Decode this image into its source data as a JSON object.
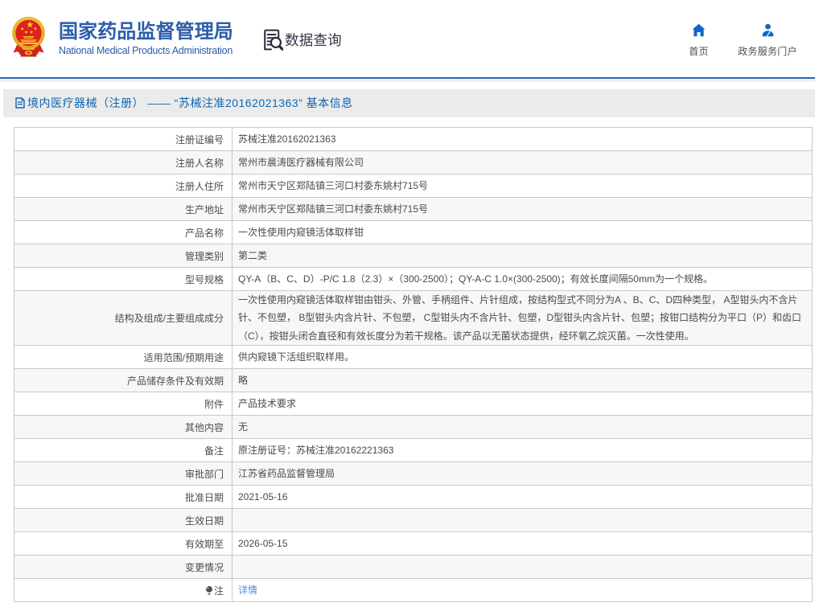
{
  "header": {
    "brand_title": "国家药品监督管理局",
    "brand_subtitle": "National Medical Products Administration",
    "data_search_label": "数据查询",
    "nav_home_label": "首页",
    "nav_portal_label": "政务服务门户"
  },
  "breadcrumb": {
    "text": "境内医疗器械（注册） —— “苏械注准20162021363” 基本信息"
  },
  "colors": {
    "brand_blue": "#2a5da9",
    "header_border_blue": "#2a65b5",
    "crumb_bar_bg": "#ebebeb",
    "crumb_text_blue": "#0d65b5",
    "table_border": "#c9c9c9",
    "row_alt_bg": "#f7f7f7",
    "link_blue": "#4192e0",
    "text_gray": "#4a4a4a"
  },
  "table": {
    "rows": [
      {
        "label": "注册证编号",
        "value": "苏械注准20162021363"
      },
      {
        "label": "注册人名称",
        "value": "常州市晨涛医疗器械有限公司"
      },
      {
        "label": "注册人住所",
        "value": "常州市天宁区郑陆镇三河口村委东姚村715号"
      },
      {
        "label": "生产地址",
        "value": "常州市天宁区郑陆镇三河口村委东姚村715号"
      },
      {
        "label": "产品名称",
        "value": "一次性使用内窥镜活体取样钳"
      },
      {
        "label": "管理类别",
        "value": "第二类"
      },
      {
        "label": "型号规格",
        "value": "QY-A（B、C、D）-P/C 1.8（2.3）×（300-2500）；QY-A-C 1.0×(300-2500)；有效长度间隔50mm为一个规格。"
      },
      {
        "label": "结构及组成/主要组成成分",
        "value": "一次性使用内窥镜活体取样钳由钳头、外管、手柄组件、片针组成，按结构型式不同分为A 、B、C、D四种类型， A型钳头内不含片针、不包塑， B型钳头内含片针、不包塑， C型钳头内不含片针、包塑，D型钳头内含片针、包塑；按钳口结构分为平口（P）和齿口（C），按钳头闭合直径和有效长度分为若干规格。该产品以无菌状态提供，经环氧乙烷灭菌。一次性使用。",
        "tall": true
      },
      {
        "label": "适用范围/预期用途",
        "value": "供内窥镜下活组织取样用。"
      },
      {
        "label": "产品储存条件及有效期",
        "value": "略"
      },
      {
        "label": "附件",
        "value": "产品技术要求"
      },
      {
        "label": "其他内容",
        "value": "无"
      },
      {
        "label": "备注",
        "value": "原注册证号：苏械注准20162221363"
      },
      {
        "label": "审批部门",
        "value": "江苏省药品监督管理局"
      },
      {
        "label": "批准日期",
        "value": "2021-05-16"
      },
      {
        "label": "生效日期",
        "value": ""
      },
      {
        "label": "有效期至",
        "value": "2026-05-15"
      },
      {
        "label": "变更情况",
        "value": ""
      },
      {
        "label": "注",
        "label_icon": "bulb",
        "value": "详情",
        "link": true
      }
    ]
  }
}
